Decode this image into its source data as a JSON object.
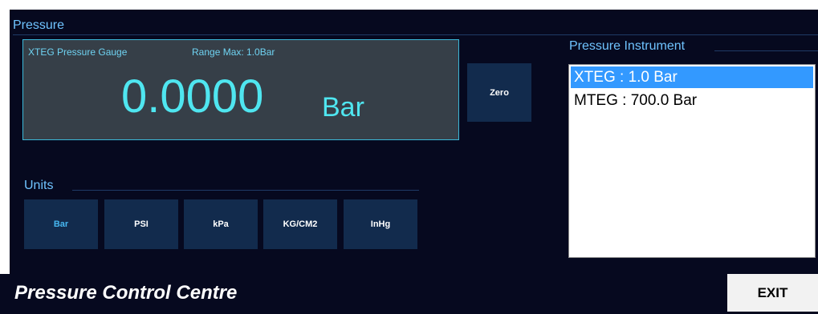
{
  "pressure": {
    "title": "Pressure",
    "gauge": {
      "name": "XTEG Pressure Gauge",
      "range": "Range Max: 1.0Bar",
      "value": "0.0000",
      "unit": "Bar"
    },
    "zero_label": "Zero"
  },
  "units": {
    "title": "Units",
    "buttons": [
      "Bar",
      "PSI",
      "kPa",
      "KG/CM2",
      "InHg"
    ],
    "selected": "Bar"
  },
  "instrument": {
    "title": "Pressure Instrument",
    "items": [
      "XTEG : 1.0 Bar",
      "MTEG : 700.0 Bar"
    ],
    "selected": "XTEG : 1.0 Bar"
  },
  "footer": {
    "title": "Pressure Control Centre",
    "exit_label": "EXIT"
  },
  "colors": {
    "background": "#06091f",
    "accent": "#3bb9d9",
    "button": "#122b4d",
    "selection": "#3399ff"
  }
}
